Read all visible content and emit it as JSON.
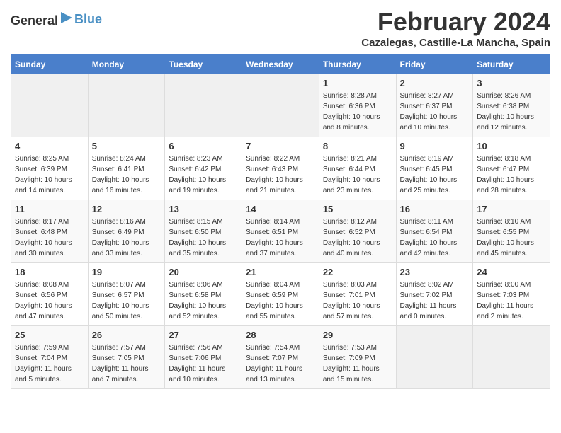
{
  "header": {
    "logo_general": "General",
    "logo_blue": "Blue",
    "title": "February 2024",
    "subtitle": "Cazalegas, Castille-La Mancha, Spain"
  },
  "calendar": {
    "days_of_week": [
      "Sunday",
      "Monday",
      "Tuesday",
      "Wednesday",
      "Thursday",
      "Friday",
      "Saturday"
    ],
    "weeks": [
      [
        {
          "day": "",
          "info": ""
        },
        {
          "day": "",
          "info": ""
        },
        {
          "day": "",
          "info": ""
        },
        {
          "day": "",
          "info": ""
        },
        {
          "day": "1",
          "info": "Sunrise: 8:28 AM\nSunset: 6:36 PM\nDaylight: 10 hours\nand 8 minutes."
        },
        {
          "day": "2",
          "info": "Sunrise: 8:27 AM\nSunset: 6:37 PM\nDaylight: 10 hours\nand 10 minutes."
        },
        {
          "day": "3",
          "info": "Sunrise: 8:26 AM\nSunset: 6:38 PM\nDaylight: 10 hours\nand 12 minutes."
        }
      ],
      [
        {
          "day": "4",
          "info": "Sunrise: 8:25 AM\nSunset: 6:39 PM\nDaylight: 10 hours\nand 14 minutes."
        },
        {
          "day": "5",
          "info": "Sunrise: 8:24 AM\nSunset: 6:41 PM\nDaylight: 10 hours\nand 16 minutes."
        },
        {
          "day": "6",
          "info": "Sunrise: 8:23 AM\nSunset: 6:42 PM\nDaylight: 10 hours\nand 19 minutes."
        },
        {
          "day": "7",
          "info": "Sunrise: 8:22 AM\nSunset: 6:43 PM\nDaylight: 10 hours\nand 21 minutes."
        },
        {
          "day": "8",
          "info": "Sunrise: 8:21 AM\nSunset: 6:44 PM\nDaylight: 10 hours\nand 23 minutes."
        },
        {
          "day": "9",
          "info": "Sunrise: 8:19 AM\nSunset: 6:45 PM\nDaylight: 10 hours\nand 25 minutes."
        },
        {
          "day": "10",
          "info": "Sunrise: 8:18 AM\nSunset: 6:47 PM\nDaylight: 10 hours\nand 28 minutes."
        }
      ],
      [
        {
          "day": "11",
          "info": "Sunrise: 8:17 AM\nSunset: 6:48 PM\nDaylight: 10 hours\nand 30 minutes."
        },
        {
          "day": "12",
          "info": "Sunrise: 8:16 AM\nSunset: 6:49 PM\nDaylight: 10 hours\nand 33 minutes."
        },
        {
          "day": "13",
          "info": "Sunrise: 8:15 AM\nSunset: 6:50 PM\nDaylight: 10 hours\nand 35 minutes."
        },
        {
          "day": "14",
          "info": "Sunrise: 8:14 AM\nSunset: 6:51 PM\nDaylight: 10 hours\nand 37 minutes."
        },
        {
          "day": "15",
          "info": "Sunrise: 8:12 AM\nSunset: 6:52 PM\nDaylight: 10 hours\nand 40 minutes."
        },
        {
          "day": "16",
          "info": "Sunrise: 8:11 AM\nSunset: 6:54 PM\nDaylight: 10 hours\nand 42 minutes."
        },
        {
          "day": "17",
          "info": "Sunrise: 8:10 AM\nSunset: 6:55 PM\nDaylight: 10 hours\nand 45 minutes."
        }
      ],
      [
        {
          "day": "18",
          "info": "Sunrise: 8:08 AM\nSunset: 6:56 PM\nDaylight: 10 hours\nand 47 minutes."
        },
        {
          "day": "19",
          "info": "Sunrise: 8:07 AM\nSunset: 6:57 PM\nDaylight: 10 hours\nand 50 minutes."
        },
        {
          "day": "20",
          "info": "Sunrise: 8:06 AM\nSunset: 6:58 PM\nDaylight: 10 hours\nand 52 minutes."
        },
        {
          "day": "21",
          "info": "Sunrise: 8:04 AM\nSunset: 6:59 PM\nDaylight: 10 hours\nand 55 minutes."
        },
        {
          "day": "22",
          "info": "Sunrise: 8:03 AM\nSunset: 7:01 PM\nDaylight: 10 hours\nand 57 minutes."
        },
        {
          "day": "23",
          "info": "Sunrise: 8:02 AM\nSunset: 7:02 PM\nDaylight: 11 hours\nand 0 minutes."
        },
        {
          "day": "24",
          "info": "Sunrise: 8:00 AM\nSunset: 7:03 PM\nDaylight: 11 hours\nand 2 minutes."
        }
      ],
      [
        {
          "day": "25",
          "info": "Sunrise: 7:59 AM\nSunset: 7:04 PM\nDaylight: 11 hours\nand 5 minutes."
        },
        {
          "day": "26",
          "info": "Sunrise: 7:57 AM\nSunset: 7:05 PM\nDaylight: 11 hours\nand 7 minutes."
        },
        {
          "day": "27",
          "info": "Sunrise: 7:56 AM\nSunset: 7:06 PM\nDaylight: 11 hours\nand 10 minutes."
        },
        {
          "day": "28",
          "info": "Sunrise: 7:54 AM\nSunset: 7:07 PM\nDaylight: 11 hours\nand 13 minutes."
        },
        {
          "day": "29",
          "info": "Sunrise: 7:53 AM\nSunset: 7:09 PM\nDaylight: 11 hours\nand 15 minutes."
        },
        {
          "day": "",
          "info": ""
        },
        {
          "day": "",
          "info": ""
        }
      ]
    ]
  }
}
